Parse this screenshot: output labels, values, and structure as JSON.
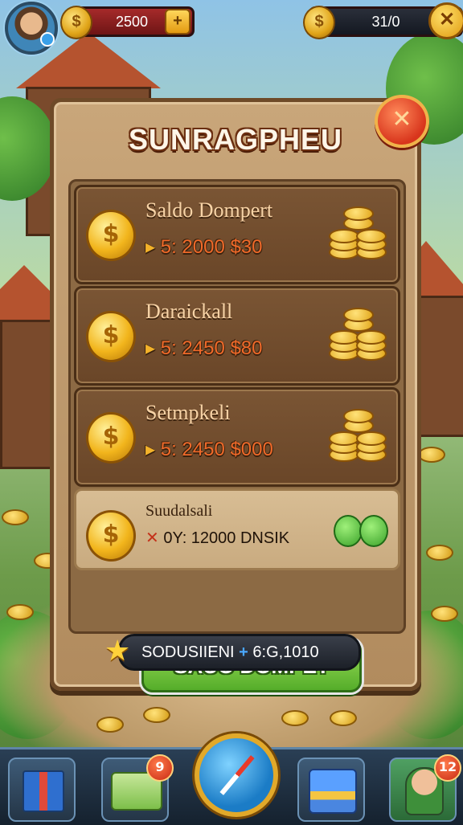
{
  "top_bar": {
    "coins_left": "2500",
    "coins_right": "31/0",
    "plus_label": "+",
    "close_label": "✕"
  },
  "panel": {
    "title": "SUNRAGPHEU",
    "close_label": "✕",
    "offers": [
      {
        "label": "Saldo Dompert",
        "price": "5: 2000 $30",
        "icon": "coin-icon"
      },
      {
        "label": "Daraickall",
        "price": "5: 2450 $80",
        "icon": "coin-icon"
      },
      {
        "label": "Setmpkeli",
        "price": "5: 2450 $000",
        "icon": "coin-icon"
      },
      {
        "label": "Suudalsali",
        "price": "0Y: 12000 DNSIK",
        "icon": "coin-icon"
      }
    ],
    "cta_label": "SAUO DOMPET",
    "footer_label": "SODUSIIENI",
    "footer_value": "6:G,1010"
  },
  "bottom_nav": {
    "badge_left": "9",
    "badge_right": "12"
  },
  "colors": {
    "panel": "#c9a67a",
    "cta_green": "#55ad2a",
    "close_red": "#d8351c",
    "coin_gold": "#f2b51c"
  }
}
